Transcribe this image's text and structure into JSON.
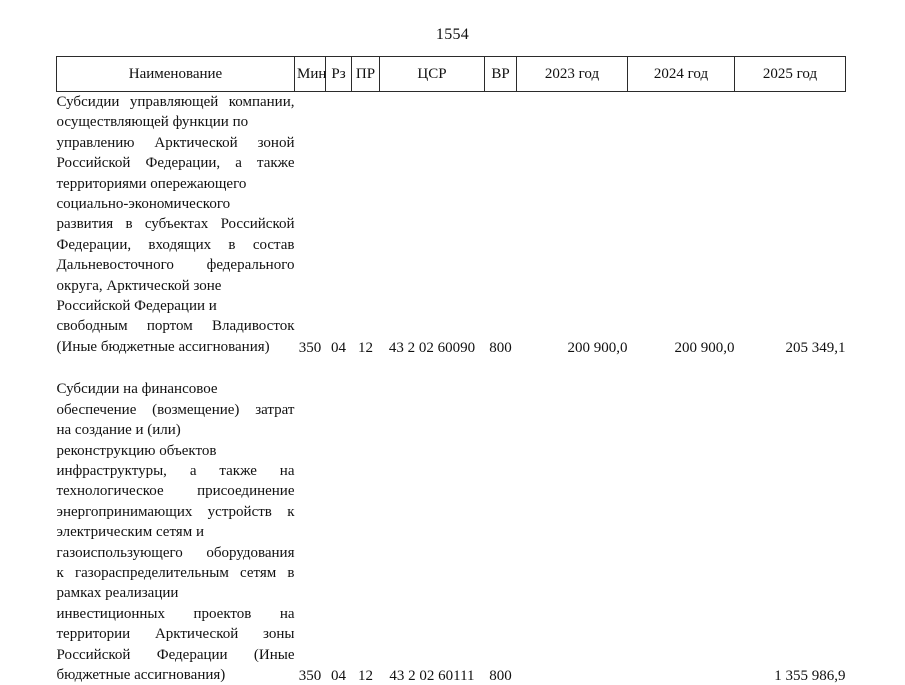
{
  "page": {
    "number": "1554"
  },
  "table": {
    "headers": {
      "name": "Наименование",
      "min": "Мин",
      "rz": "Рз",
      "pr": "ПР",
      "csr": "ЦСР",
      "vr": "ВР",
      "year1": "2023 год",
      "year2": "2024 год",
      "year3": "2025 год"
    },
    "rows": [
      {
        "description_lines": [
          "Субсидии управляющей компании,",
          "осуществляющей функции по",
          "управлению Арктической зоной",
          "Российской Федерации, а также",
          "территориями опережающего",
          "социально-экономического",
          "развития в субъектах Российской",
          "Федерации, входящих в состав",
          "Дальневосточного федерального",
          "округа, Арктической зоне",
          "Российской Федерации и",
          "свободным портом Владивосток",
          "(Иные бюджетные ассигнования)"
        ],
        "min": "350",
        "rz": "04",
        "pr": "12",
        "csr": "43 2 02 60090",
        "vr": "800",
        "year1": "200 900,0",
        "year2": "200 900,0",
        "year3": "205 349,1"
      },
      {
        "description_lines": [
          "Субсидии на финансовое",
          "обеспечение (возмещение) затрат",
          "на создание и (или)",
          "реконструкцию объектов",
          "инфраструктуры, а также на",
          "технологическое присоединение",
          "энергопринимающих устройств к",
          "электрическим сетям и",
          "газоиспользующего оборудования",
          "к газораспределительным сетям в",
          "рамках реализации",
          "инвестиционных проектов на",
          "территории Арктической зоны",
          "Российской Федерации (Иные",
          "бюджетные ассигнования)"
        ],
        "min": "350",
        "rz": "04",
        "pr": "12",
        "csr": "43 2 02 60111",
        "vr": "800",
        "year1": "",
        "year2": "",
        "year3": "1 355 986,9"
      }
    ]
  }
}
